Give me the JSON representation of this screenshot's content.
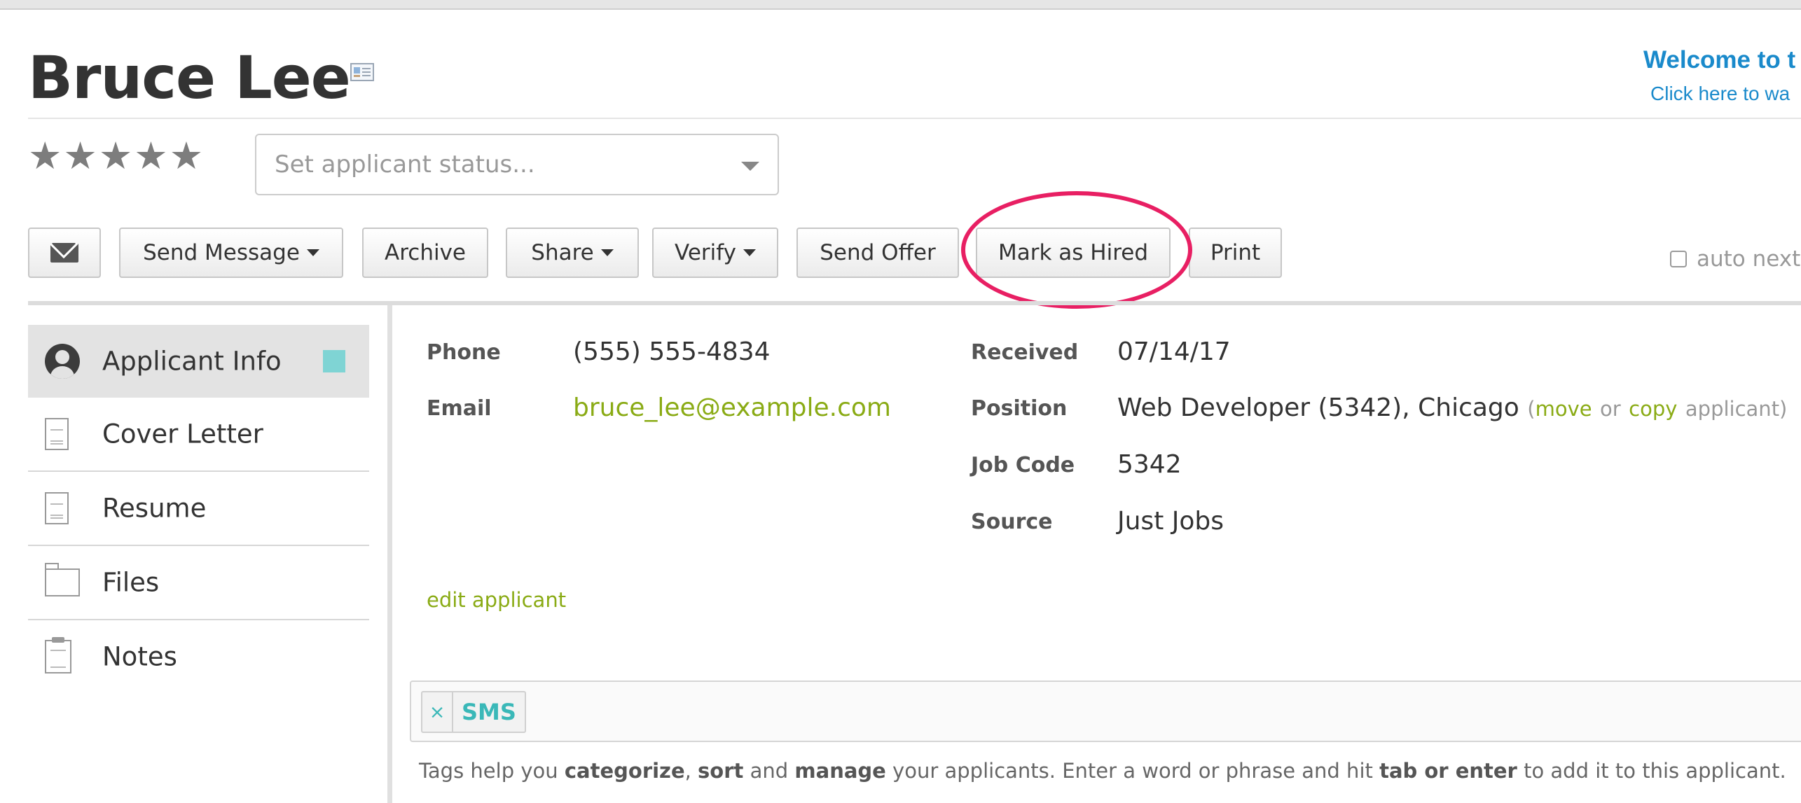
{
  "applicant": {
    "name": "Bruce Lee",
    "rating_stars": 5
  },
  "welcome": {
    "title": "Welcome to t",
    "subtitle": "Click here to wa"
  },
  "status": {
    "placeholder": "Set applicant status..."
  },
  "toolbar": {
    "email_icon": "envelope-icon",
    "send_message": "Send Message",
    "archive": "Archive",
    "share": "Share",
    "verify": "Verify",
    "send_offer": "Send Offer",
    "mark_as_hired": "Mark as Hired",
    "print": "Print",
    "auto_next": "auto next"
  },
  "sidebar": {
    "items": [
      {
        "label": "Applicant Info",
        "icon": "user-icon",
        "active": true
      },
      {
        "label": "Cover Letter",
        "icon": "document-icon"
      },
      {
        "label": "Resume",
        "icon": "document-icon"
      },
      {
        "label": "Files",
        "icon": "folder-icon"
      },
      {
        "label": "Notes",
        "icon": "clipboard-icon"
      }
    ],
    "active_marker_color": "#7fd4d4"
  },
  "details": {
    "phone_label": "Phone",
    "phone": "(555) 555-4834",
    "email_label": "Email",
    "email": "bruce_lee@example.com",
    "received_label": "Received",
    "received": "07/14/17",
    "position_label": "Position",
    "position": "Web Developer (5342), Chicago",
    "position_paren_open": "(",
    "move_link": "move",
    "or_text": "or",
    "copy_link": "copy",
    "applicant_suffix": "applicant)",
    "job_code_label": "Job Code",
    "job_code": "5342",
    "source_label": "Source",
    "source": "Just Jobs",
    "edit_link": "edit applicant"
  },
  "tags": {
    "items": [
      {
        "label": "SMS",
        "remove": "×"
      }
    ],
    "help": {
      "p1": "Tags help you ",
      "b1": "categorize",
      "p2": ", ",
      "b2": "sort",
      "p3": " and ",
      "b3": "manage",
      "p4": " your applicants. Enter a word or phrase and hit ",
      "b4": "tab or enter",
      "p5": " to add it to this applicant."
    }
  },
  "colors": {
    "link": "#8aab15",
    "welcome": "#1a8acb",
    "highlight": "#e81f63",
    "tag": "#3ab8b8"
  }
}
